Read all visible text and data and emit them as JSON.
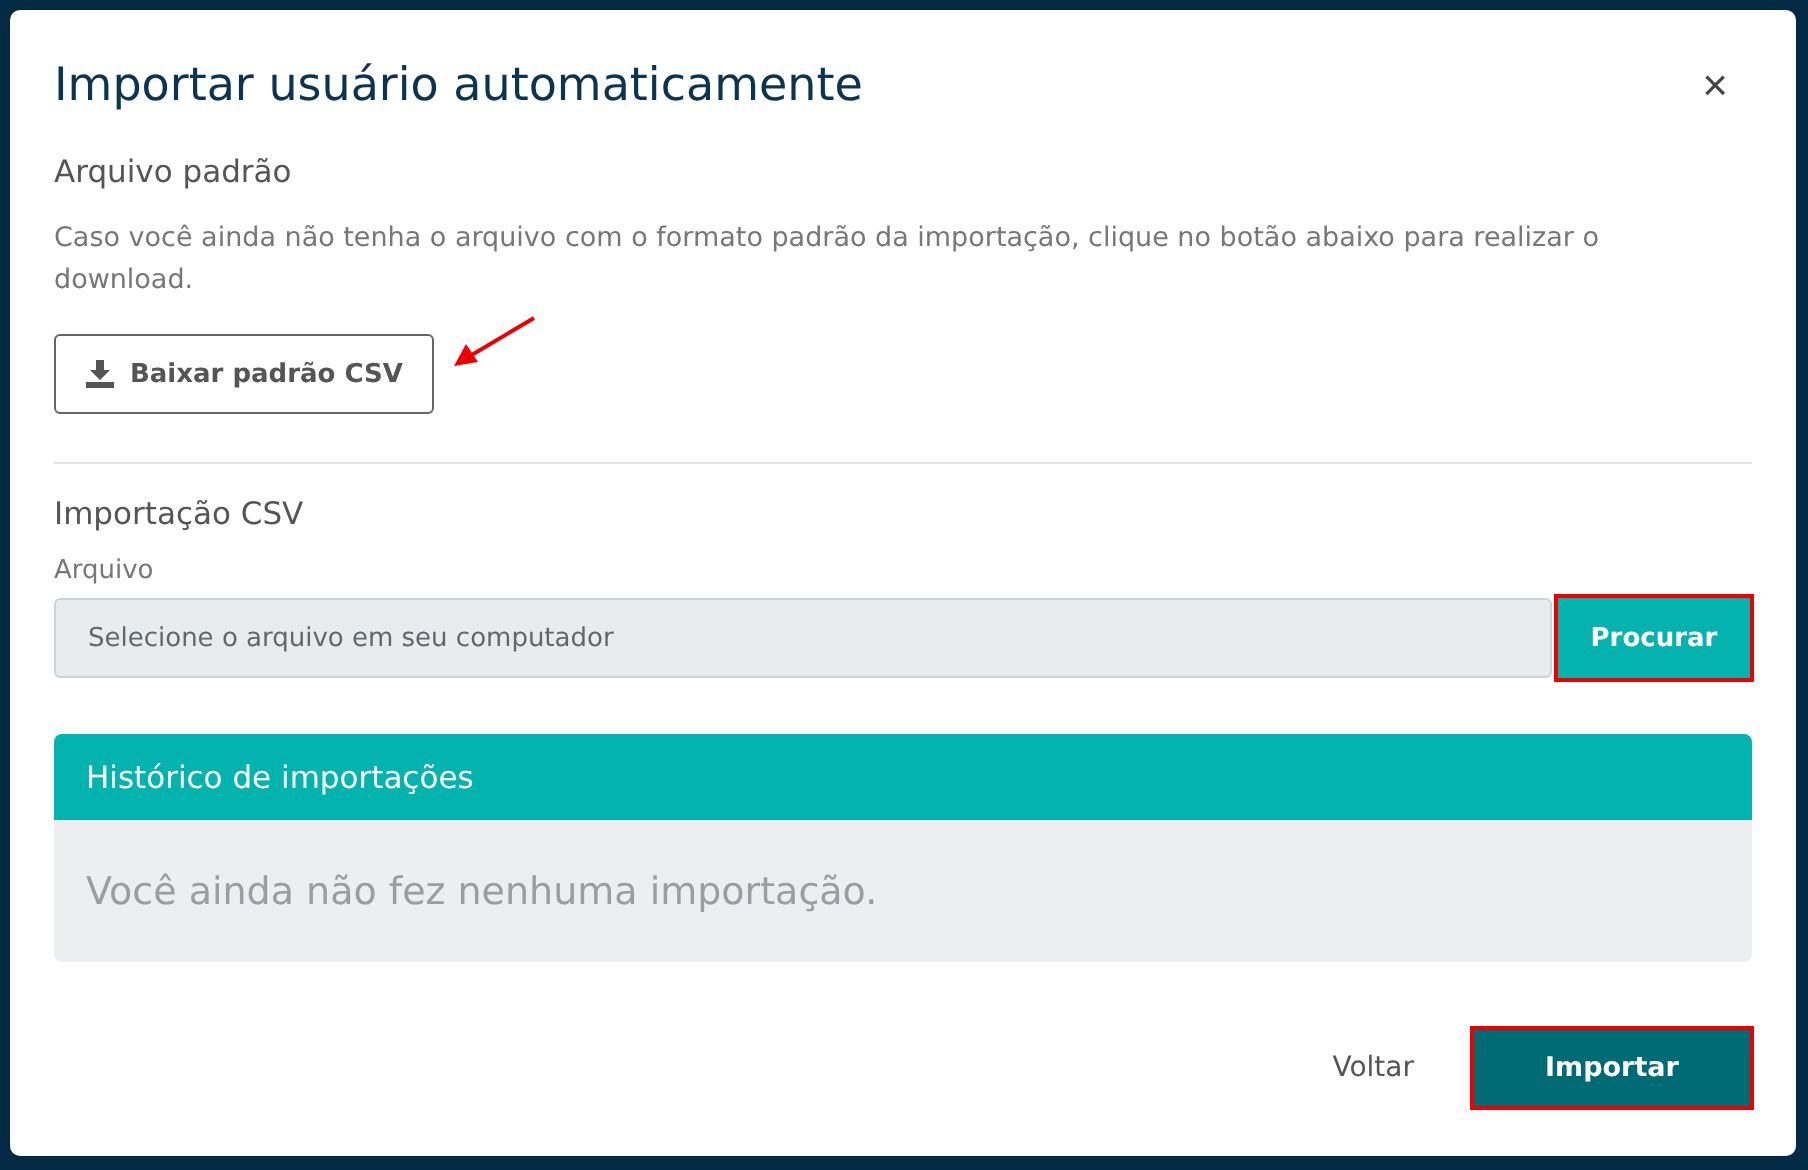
{
  "dialog": {
    "title": "Importar usuário automaticamente",
    "close": "×"
  },
  "template": {
    "heading": "Arquivo padrão",
    "text": "Caso você ainda não tenha o arquivo com o formato padrão da importação, clique no botão abaixo para realizar o download.",
    "button": {
      "label": "Baixar padrão CSV",
      "highlighted": false
    }
  },
  "csv_import": {
    "heading": "Importação CSV",
    "field_label": "Arquivo",
    "placeholder": "Selecione o arquivo em seu computador",
    "browse": {
      "label": "Procurar",
      "highlighted": true
    }
  },
  "history": {
    "title": "Histórico de importações",
    "empty_text": "Você ainda não fez nenhuma importação."
  },
  "footer": {
    "back": "Voltar",
    "submit": {
      "label": "Importar",
      "highlighted": true
    }
  }
}
